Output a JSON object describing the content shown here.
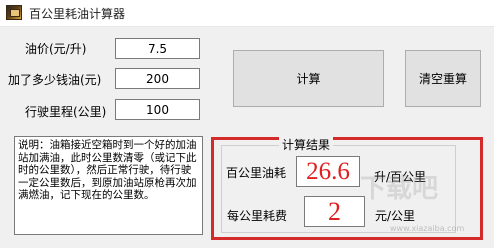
{
  "window": {
    "title": "百公里耗油计算器"
  },
  "form": {
    "price_label": "油价(元/升)",
    "price_value": "7.5",
    "money_label": "加了多少钱油(元)",
    "money_value": "200",
    "distance_label": "行驶里程(公里)",
    "distance_value": "100"
  },
  "buttons": {
    "calculate": "计算",
    "clear": "清空重算"
  },
  "note": "说明：油箱接近空箱时到一个好的加油站加满油，此时公里数清零（或记下此时的公里数），然后正常行驶，待行驶一定公里数后，到原加油站原枪再次加满燃油，记下现在的公里数。",
  "results": {
    "group_title": "计算结果",
    "per100_label": "百公里油耗",
    "per100_value": "26.6",
    "per100_unit": "升/百公里",
    "perkm_label": "每公里耗费",
    "perkm_value": "2",
    "perkm_unit": "元/公里"
  },
  "colors": {
    "highlight": "#d42a2a",
    "result_text": "#e02020"
  },
  "watermark": {
    "text": "下载吧",
    "url": "www.xiazaiba.com"
  }
}
